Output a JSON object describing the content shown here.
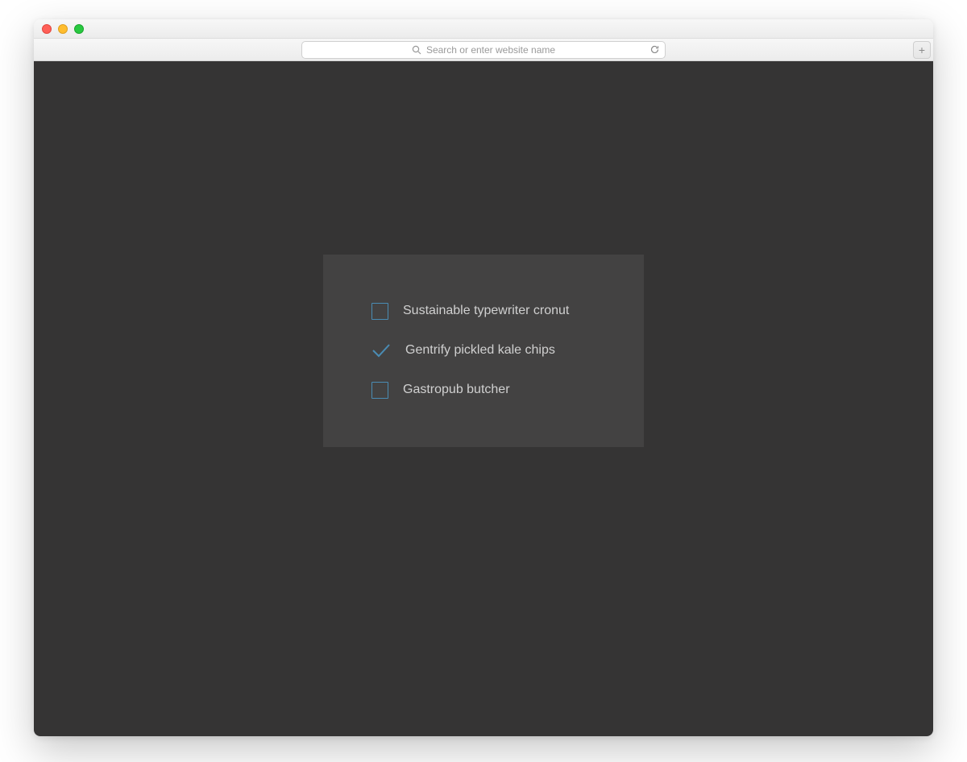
{
  "browser": {
    "address_placeholder": "Search or enter website name",
    "newtab_glyph": "+"
  },
  "panel": {
    "items": [
      {
        "label": "Sustainable typewriter cronut",
        "checked": false
      },
      {
        "label": "Gentrify pickled kale chips",
        "checked": true
      },
      {
        "label": "Gastropub butcher",
        "checked": false
      }
    ]
  },
  "colors": {
    "page_bg": "#353434",
    "panel_bg": "#434242",
    "accent": "#4a8cb4",
    "label": "#d0d0d0"
  }
}
